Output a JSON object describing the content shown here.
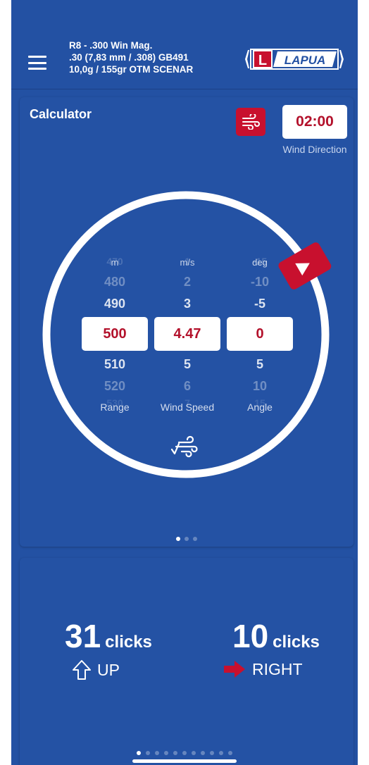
{
  "ammo": {
    "line1": "R8 - .300 Win Mag.",
    "line2": ".30 (7,83 mm / .308) GB491",
    "line3": "10,0g / 155gr OTM SCENAR"
  },
  "logo": {
    "text": "LAPUA",
    "letter": "L"
  },
  "calculator": {
    "title": "Calculator",
    "wind_time": "02:00",
    "wind_direction_label": "Wind Direction",
    "columns": [
      {
        "unit": "m",
        "top_faded": "470",
        "above2": "480",
        "above1": "490",
        "selected": "500",
        "below1": "510",
        "below2": "520",
        "bottom_faded": "530",
        "label": "Range"
      },
      {
        "unit": "m/s",
        "top_faded": "1",
        "above2": "2",
        "above1": "3",
        "selected": "4.47",
        "below1": "5",
        "below2": "6",
        "bottom_faded": "7",
        "label": "Wind Speed"
      },
      {
        "unit": "deg",
        "top_faded": "-15",
        "above2": "-10",
        "above1": "-5",
        "selected": "0",
        "below1": "5",
        "below2": "10",
        "bottom_faded": "15",
        "label": "Angle"
      }
    ],
    "page_dots": 3,
    "active_dot": 0
  },
  "result": {
    "vertical_clicks": "31",
    "vertical_word": "clicks",
    "vertical_dir": "UP",
    "horizontal_clicks": "10",
    "horizontal_word": "clicks",
    "horizontal_dir": "RIGHT"
  },
  "pager": {
    "count": 11,
    "active": 0
  },
  "colors": {
    "background": "#2351a3",
    "card": "#2452a4",
    "accent_red": "#c8102e",
    "selected_text": "#b3112b"
  },
  "icons": [
    "menu-icon",
    "wind-icon",
    "wind-direction-handle-icon",
    "wind-check-icon",
    "arrow-up-icon",
    "arrow-right-icon"
  ]
}
